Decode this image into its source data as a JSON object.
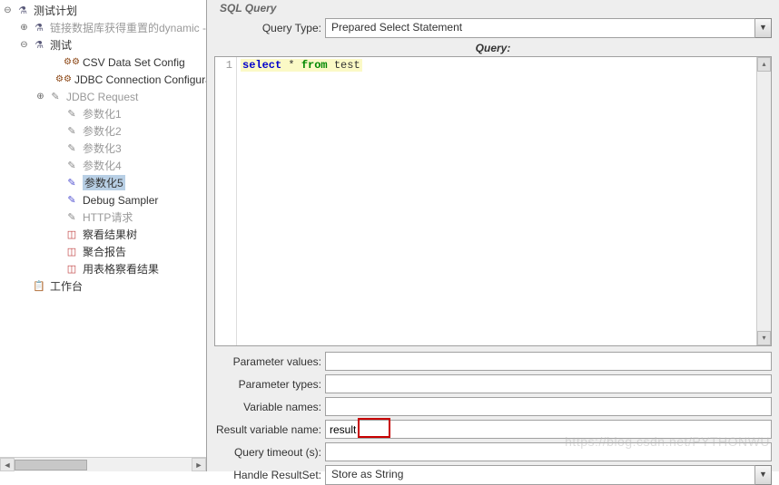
{
  "tree": {
    "root": "测试计划",
    "n1": "链接数据库获得重置的dynamic -",
    "n2": "测试",
    "n3": "CSV Data Set Config",
    "n4": "JDBC Connection Configurati",
    "n5": "JDBC Request",
    "n6": "参数化1",
    "n7": "参数化2",
    "n8": "参数化3",
    "n9": "参数化4",
    "n10": "参数化5",
    "n11": "Debug Sampler",
    "n12": "HTTP请求",
    "n13": "察看结果树",
    "n14": "聚合报告",
    "n15": "用表格察看结果",
    "n16": "工作台"
  },
  "panel": {
    "section": "SQL Query",
    "queryTypeLabel": "Query Type:",
    "queryTypeValue": "Prepared Select Statement",
    "queryLabel": "Query:",
    "line_no": "1",
    "sql_kw1": "select",
    "sql_star": " * ",
    "sql_kw2": "from",
    "sql_rest": " test",
    "paramValuesLabel": "Parameter values:",
    "paramValues": "",
    "paramTypesLabel": "Parameter types:",
    "paramTypes": "",
    "varNamesLabel": "Variable names:",
    "varNames": "",
    "resultVarLabel": "Result variable name:",
    "resultVar": "result",
    "queryTimeoutLabel": "Query timeout (s):",
    "queryTimeout": "",
    "handleResultLabel": "Handle ResultSet:",
    "handleResultValue": "Store as String"
  },
  "watermark": "https://blog.csdn.net/PYTHONWU"
}
